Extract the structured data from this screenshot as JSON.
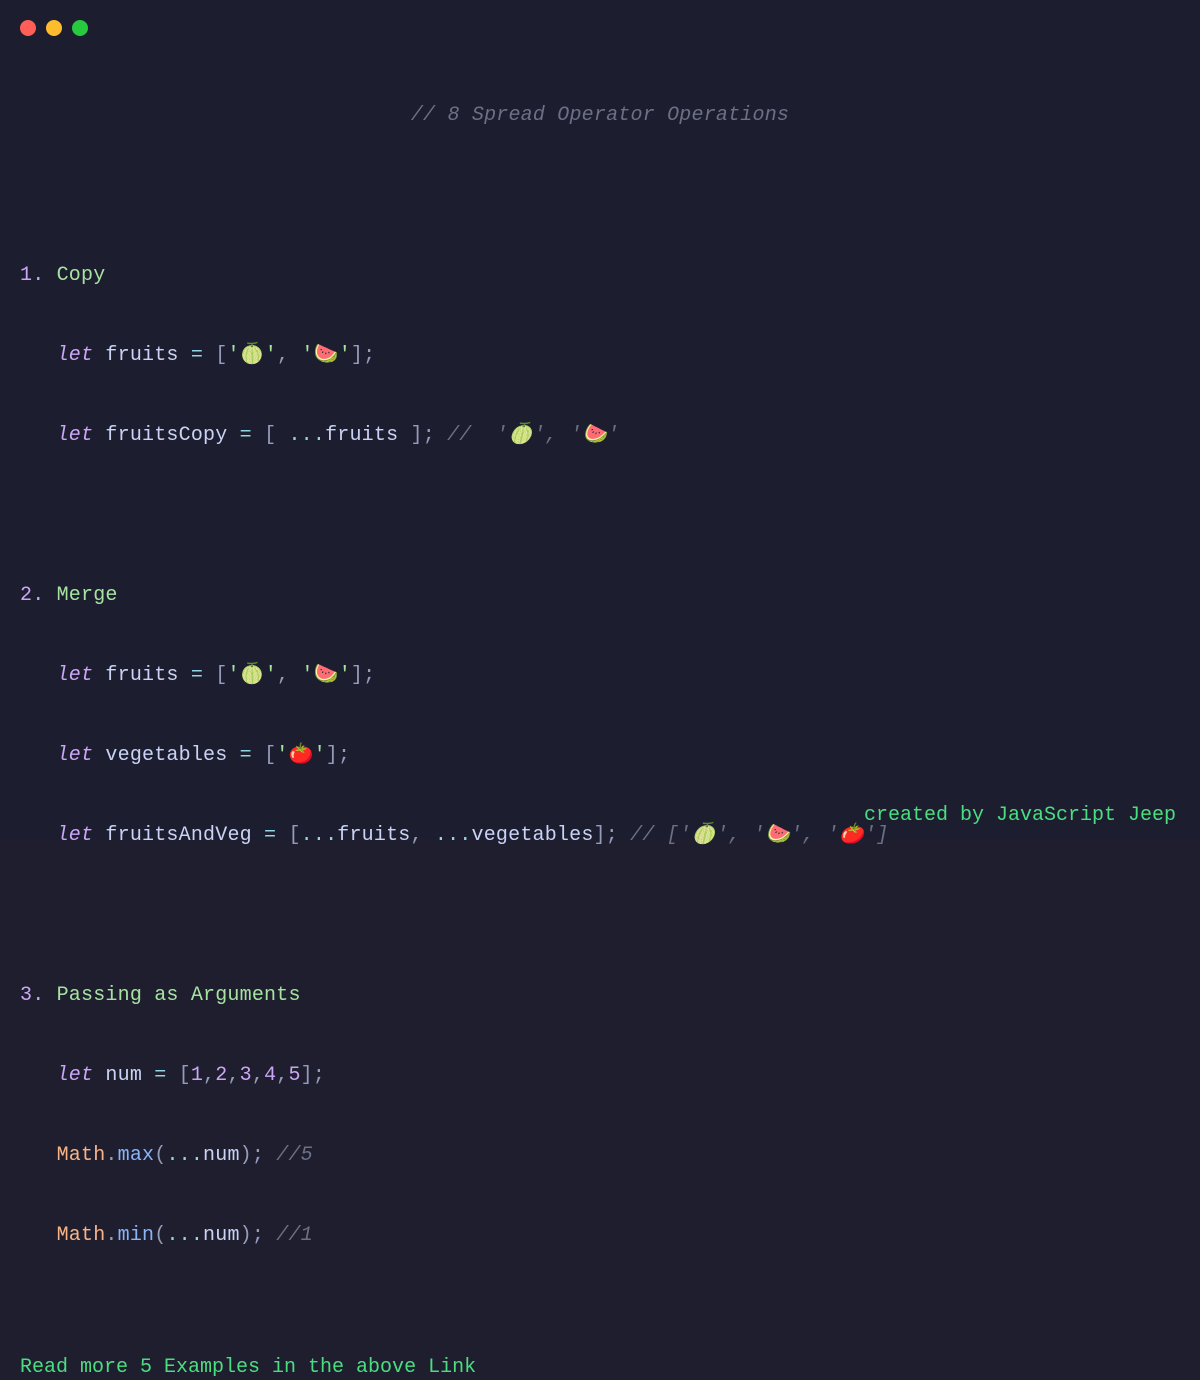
{
  "titleComment": "// 8 Spread Operator Operations",
  "sections": {
    "s1": {
      "num": "1.",
      "title": " Copy"
    },
    "s2": {
      "num": "2.",
      "title": " Merge"
    },
    "s3": {
      "num": "3.",
      "title": " Passing as Arguments"
    }
  },
  "tokens": {
    "let": "let",
    "fruits": "fruits",
    "fruitsCopy": "fruitsCopy",
    "vegetables": "vegetables",
    "fruitsAndVeg": "fruitsAndVeg",
    "num": "num",
    "eq": " = ",
    "lb": "[",
    "rb": "]",
    "lp": "(",
    "rp": ")",
    "semi": ";",
    "comma": ", ",
    "commaTight": ",",
    "dots": "...",
    "dot": ".",
    "q": "'",
    "melon": "🍈",
    "watermelon": "🍉",
    "tomato": "🍅",
    "mathClass": "Math",
    "max": "max",
    "min": "min",
    "nums": {
      "n1": "1",
      "n2": "2",
      "n3": "3",
      "n4": "4",
      "n5": "5"
    }
  },
  "comments": {
    "copyOut": " //  '🍈', '🍉'",
    "mergeOut": " // ['🍈', '🍉', '🍅']",
    "maxOut": " //5",
    "minOut": " //1"
  },
  "footerLink": "Read more 5 Examples in the above Link",
  "credit": "created by JavaScript Jeep"
}
